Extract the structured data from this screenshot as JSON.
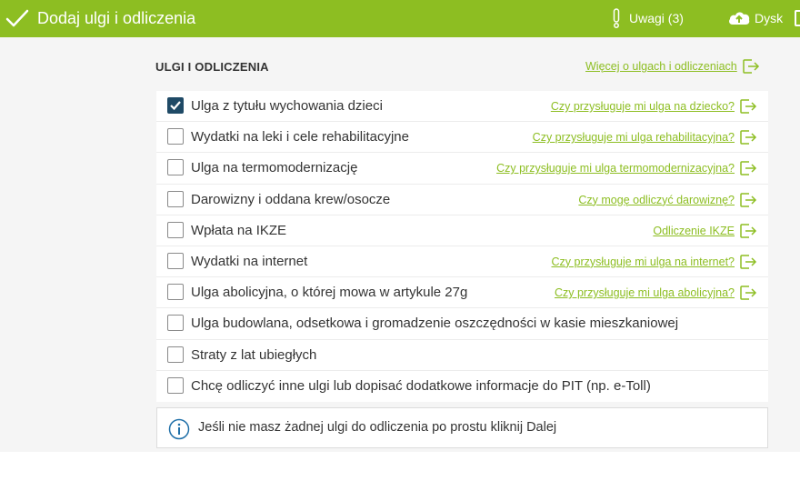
{
  "header": {
    "title": "Dodaj ulgi i odliczenia",
    "remarks_label": "Uwagi (3)",
    "disk_label": "Dysk",
    "color": "#8dbe22"
  },
  "section": {
    "heading": "ULGI I ODLICZENIA",
    "more_link": "Więcej o ulgach i odliczeniach"
  },
  "items": [
    {
      "label": "Ulga z tytułu wychowania dzieci",
      "checked": true,
      "link": "Czy przysługuje mi ulga na dziecko?"
    },
    {
      "label": "Wydatki na leki i cele rehabilitacyjne",
      "checked": false,
      "link": "Czy przysługuje mi ulga rehabilitacyjna?"
    },
    {
      "label": "Ulga na termomodernizację",
      "checked": false,
      "link": "Czy przysługuje mi ulga termomodernizacyjna?"
    },
    {
      "label": "Darowizny i oddana krew/osocze",
      "checked": false,
      "link": "Czy mogę odliczyć darowiznę?"
    },
    {
      "label": "Wpłata na IKZE",
      "checked": false,
      "link": "Odliczenie IKZE"
    },
    {
      "label": "Wydatki na internet",
      "checked": false,
      "link": "Czy przysługuje mi ulga na internet?"
    },
    {
      "label": "Ulga abolicyjna, o której mowa w artykule 27g",
      "checked": false,
      "link": "Czy przysługuje mi ulga abolicyjna?"
    },
    {
      "label": "Ulga budowlana, odsetkowa i gromadzenie oszczędności w kasie mieszkaniowej",
      "checked": false,
      "link": ""
    },
    {
      "label": "Straty z lat ubiegłych",
      "checked": false,
      "link": ""
    },
    {
      "label": "Chcę odliczyć inne ulgi lub dopisać dodatkowe informacje do PIT (np. e-Toll)",
      "checked": false,
      "link": ""
    }
  ],
  "info": {
    "text": "Jeśli nie masz żadnej ulgi do odliczenia po prostu kliknij Dalej",
    "icon": "info-icon",
    "icon_color": "#1f6fa8"
  },
  "colors": {
    "accent": "#8dbe22",
    "checkbox_checked": "#1f4a66"
  }
}
